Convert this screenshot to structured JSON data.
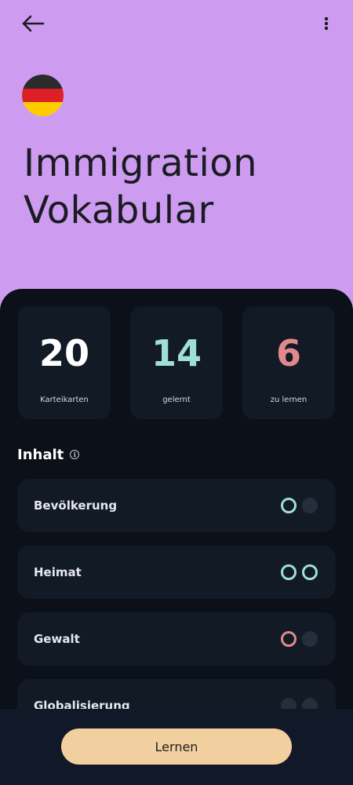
{
  "header": {
    "title_line1": "Immigration",
    "title_line2": "Vokabular",
    "back_icon": "arrow-left-icon",
    "menu_icon": "more-vertical-icon",
    "flag_colors": [
      "#2b2b2b",
      "#dd1f26",
      "#ffcc00"
    ]
  },
  "stats": [
    {
      "value": "20",
      "label": "Karteikarten",
      "color": "#ffffff"
    },
    {
      "value": "14",
      "label": "gelernt",
      "color": "#9ee0d4"
    },
    {
      "value": "6",
      "label": "zu lernen",
      "color": "#e0898d"
    }
  ],
  "section": {
    "title": "Inhalt",
    "info_icon": "info-icon"
  },
  "topics": [
    {
      "name": "Bevölkerung",
      "dots": [
        "learned",
        "empty"
      ]
    },
    {
      "name": "Heimat",
      "dots": [
        "learned",
        "learned"
      ]
    },
    {
      "name": "Gewalt",
      "dots": [
        "tolearn",
        "empty"
      ]
    },
    {
      "name": "Globalisierung",
      "dots": [
        "empty",
        "empty"
      ]
    }
  ],
  "footer": {
    "learn_label": "Lernen"
  }
}
